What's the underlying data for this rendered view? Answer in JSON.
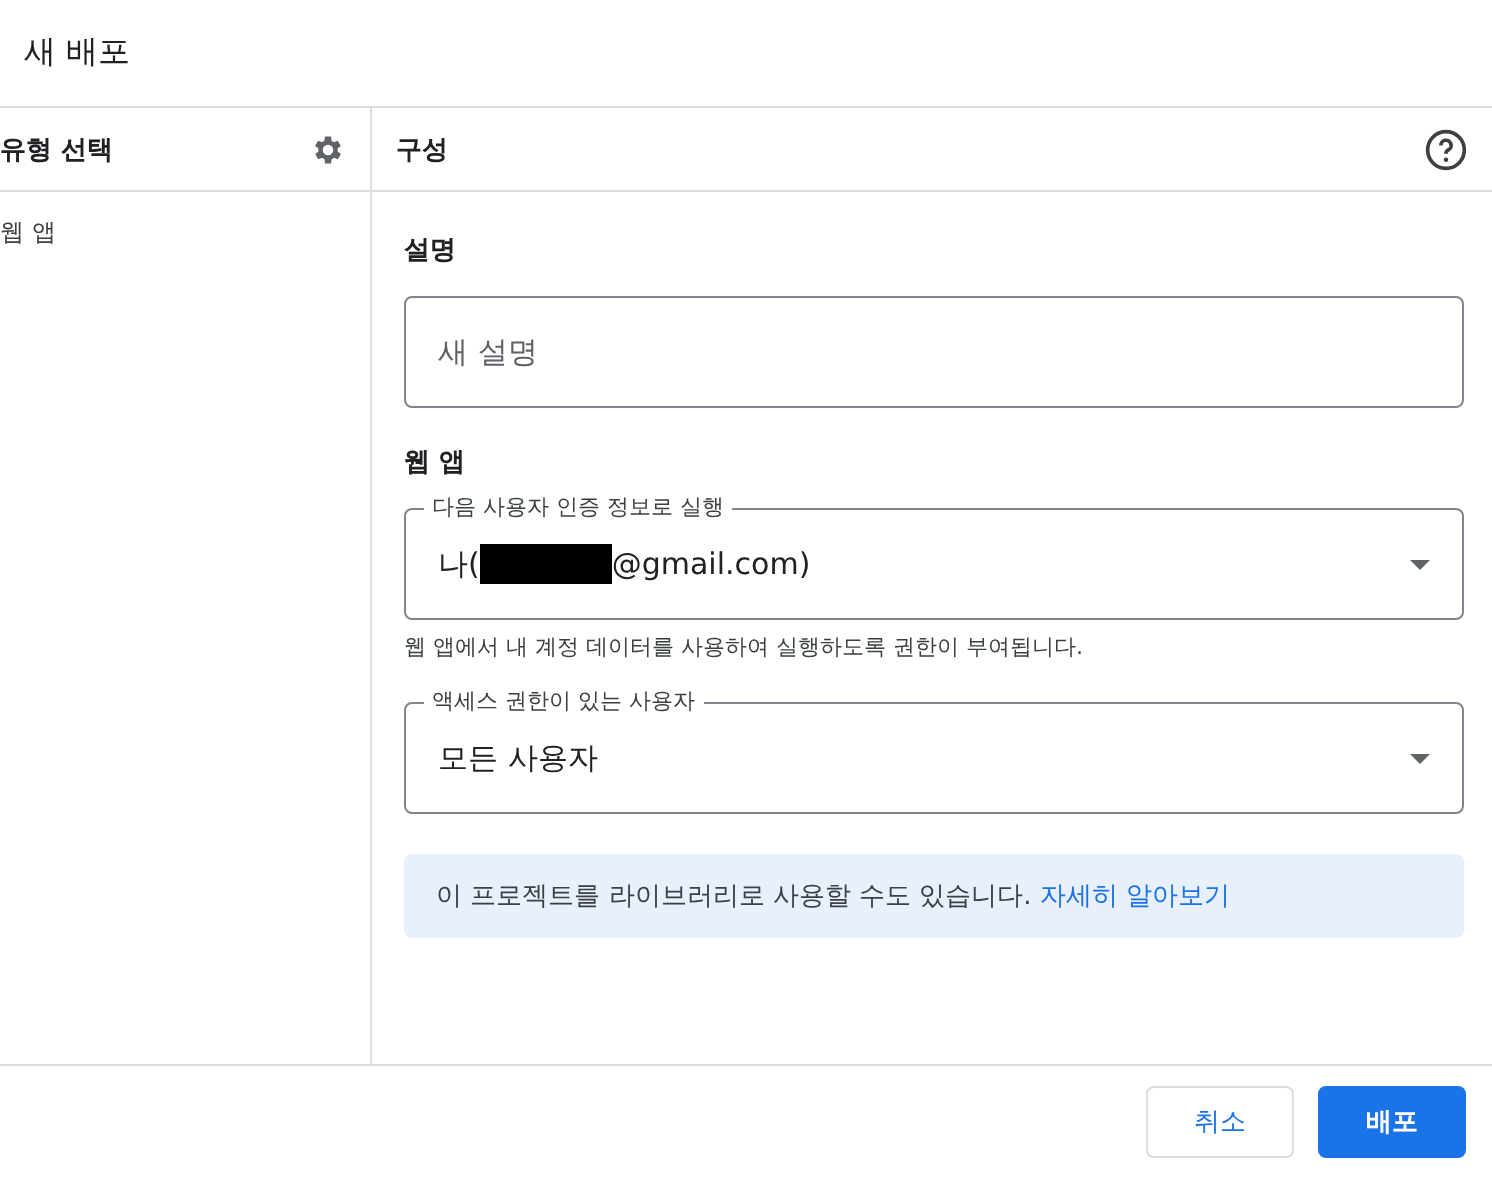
{
  "dialog": {
    "title": "새 배포"
  },
  "sidebar": {
    "title": "유형 선택",
    "items": [
      {
        "label": "웹 앱",
        "selected": false
      }
    ]
  },
  "panel": {
    "title": "구성",
    "description_label": "설명",
    "description": {
      "placeholder": "새 설명"
    },
    "section_title": "웹 앱",
    "execute_as": {
      "label": "다음 사용자 인증 정보로 실행",
      "value_prefix": "나(",
      "redacted": true,
      "value_suffix": "@gmail.com)",
      "helper": "웹 앱에서 내 계정 데이터를 사용하여 실행하도록 권한이 부여됩니다."
    },
    "access": {
      "label": "액세스 권한이 있는 사용자",
      "value": "모든 사용자"
    },
    "info": {
      "text": "이 프로젝트를 라이브러리로 사용할 수도 있습니다.",
      "link": "자세히 알아보기"
    }
  },
  "buttons": [
    {
      "label": "취소",
      "kind": "secondary"
    },
    {
      "label": "배포",
      "kind": "primary"
    }
  ]
}
